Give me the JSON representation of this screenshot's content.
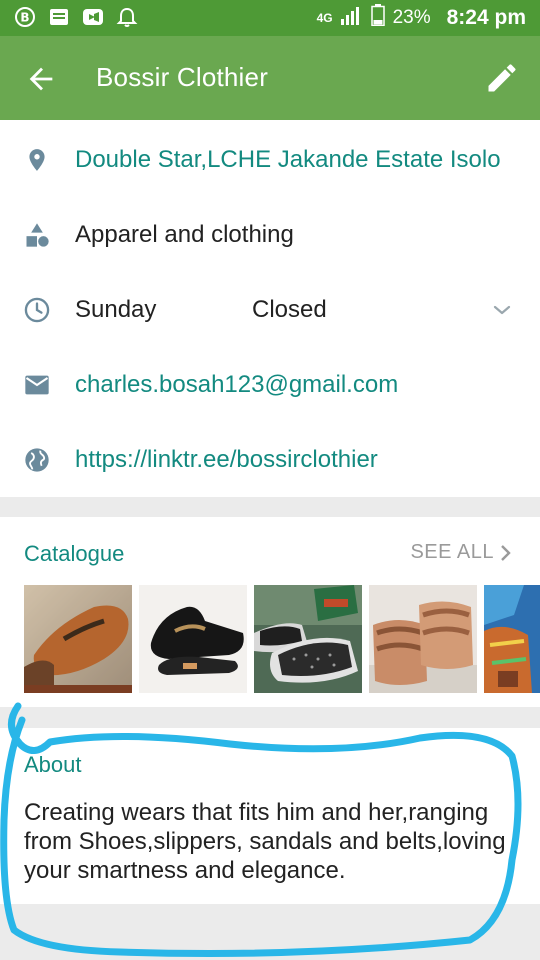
{
  "status_bar": {
    "network": "4G",
    "battery": "23%",
    "time": "8:24 pm",
    "icons": [
      "b-badge-icon",
      "message-icon",
      "video-icon",
      "bell-icon",
      "signal-icon",
      "battery-icon"
    ]
  },
  "app_bar": {
    "title": "Bossir Clothier",
    "back_icon": "arrow-left-icon",
    "edit_icon": "pencil-icon"
  },
  "info": {
    "address": "Double Star,LCHE Jakande Estate Isolo",
    "category": "Apparel and clothing",
    "hours_day": "Sunday",
    "hours_status": "Closed",
    "email": "charles.bosah123@gmail.com",
    "website": "https://linktr.ee/bossirclothier"
  },
  "catalogue": {
    "title": "Catalogue",
    "see_all": "SEE ALL",
    "items": [
      {
        "label": "tan suede loafer"
      },
      {
        "label": "black loafer with chain"
      },
      {
        "label": "black sequin sneakers"
      },
      {
        "label": "tan leather slides"
      },
      {
        "label": "blue patterned shoe"
      }
    ]
  },
  "about": {
    "title": "About",
    "text": "Creating wears that fits him and her,ranging from Shoes,slippers, sandals and belts,loving your smartness and elegance."
  },
  "colors": {
    "status_bar": "#4e9a36",
    "app_bar": "#6aa850",
    "accent_teal": "#138a80",
    "annotation_blue": "#29b6e8"
  }
}
